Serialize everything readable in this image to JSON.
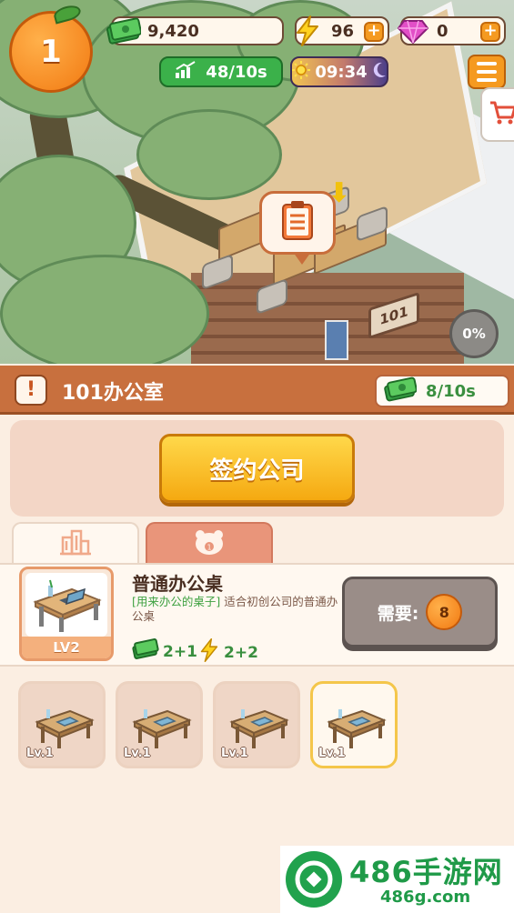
{
  "hud": {
    "player_level": "1",
    "cash": "9,420",
    "energy": "96",
    "gems": "0",
    "income_rate": "48/10s",
    "clock": "09:34"
  },
  "scene": {
    "door_number": "101",
    "room_progress": "0%"
  },
  "room": {
    "title": "101办公室",
    "income": "8/10s"
  },
  "sign_company": {
    "button_label": "签约公司"
  },
  "item": {
    "name": "普通办公桌",
    "desc_highlight": "[用来办公的桌子]",
    "desc_rest": "适合初创公司的普通办公桌",
    "level": "LV2",
    "cash_bonus": "2+1",
    "energy_bonus": "2+2",
    "need_label": "需要:",
    "need_amount": "8"
  },
  "slots": [
    {
      "level": "Lv.1",
      "selected": false
    },
    {
      "level": "Lv.1",
      "selected": false
    },
    {
      "level": "Lv.1",
      "selected": false
    },
    {
      "level": "Lv.1",
      "selected": true
    }
  ],
  "watermark": {
    "brand": "486手游网",
    "url": "486g.com"
  },
  "colors": {
    "accent_orange": "#f59a20",
    "room_bar": "#c8703e",
    "income_green": "#3bb14a",
    "sign_button": "#f5a911"
  }
}
